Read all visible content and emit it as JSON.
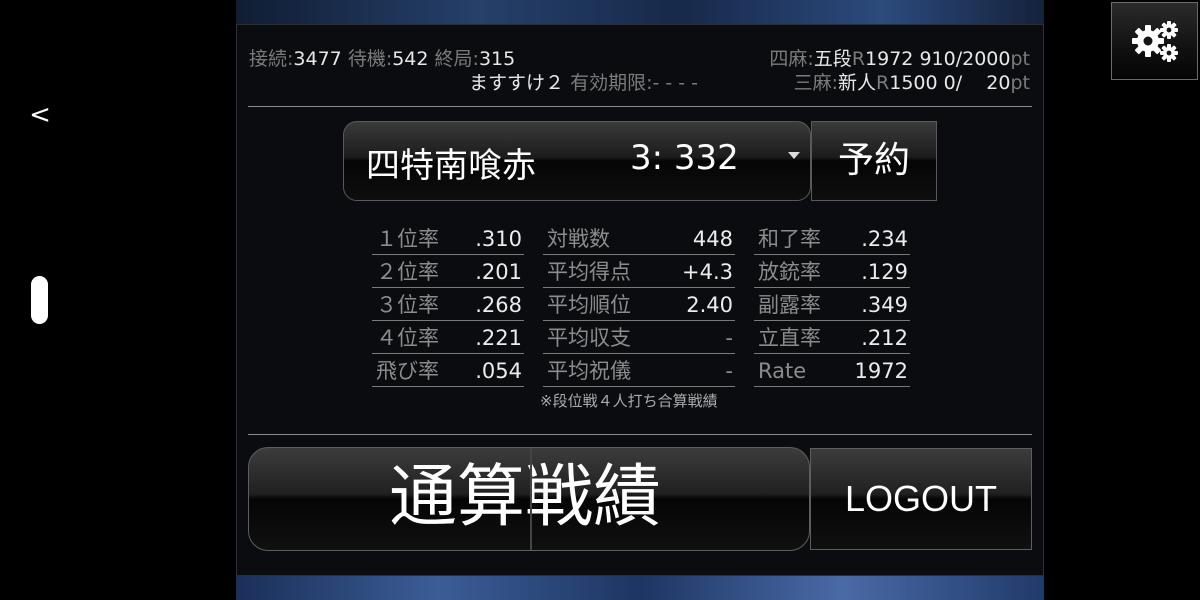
{
  "nav": {
    "back_glyph": "<"
  },
  "header": {
    "connected_label": "接続:",
    "connected_value": "3477",
    "waiting_label": "待機:",
    "waiting_value": "542",
    "finished_label": "終局:",
    "finished_value": "315",
    "player_name": "ますすけ２",
    "valid_label": "有効期限:",
    "valid_value": "- - - -",
    "yonma_label": "四麻:",
    "yonma_rank": "五段",
    "yonma_r_label": "R",
    "yonma_r_value": "1972",
    "yonma_pt_current": "910",
    "yonma_pt_max": "/2000",
    "yonma_pt_unit": "pt",
    "sanma_label": "三麻:",
    "sanma_rank": "新人",
    "sanma_r_label": "R",
    "sanma_r_value": "1500",
    "sanma_pt_current": "0",
    "sanma_pt_max": "/    20",
    "sanma_pt_unit": "pt"
  },
  "mode": {
    "name": "四特南喰赤",
    "count": "3: 332"
  },
  "buttons": {
    "reserve": "予約",
    "total_stats": "通算戦績",
    "logout": "LOGOUT"
  },
  "stats": {
    "col1": [
      {
        "label": "１位率",
        "value": ".310"
      },
      {
        "label": "２位率",
        "value": ".201"
      },
      {
        "label": "３位率",
        "value": ".268"
      },
      {
        "label": "４位率",
        "value": ".221"
      },
      {
        "label": "飛び率",
        "value": ".054"
      }
    ],
    "col2": [
      {
        "label": "対戦数",
        "value": "448"
      },
      {
        "label": "平均得点",
        "value": "+4.3"
      },
      {
        "label": "平均順位",
        "value": "2.40"
      },
      {
        "label": "平均収支",
        "value": "-"
      },
      {
        "label": "平均祝儀",
        "value": "-"
      }
    ],
    "col3": [
      {
        "label": "和了率",
        "value": ".234"
      },
      {
        "label": "放銃率",
        "value": ".129"
      },
      {
        "label": "副露率",
        "value": ".349"
      },
      {
        "label": "立直率",
        "value": ".212"
      },
      {
        "label": "Rate",
        "value": "1972"
      }
    ],
    "note": "※段位戦４人打ち合算戦績"
  },
  "icons": {
    "back": "chevron-left-icon",
    "settings": "gears-icon"
  }
}
